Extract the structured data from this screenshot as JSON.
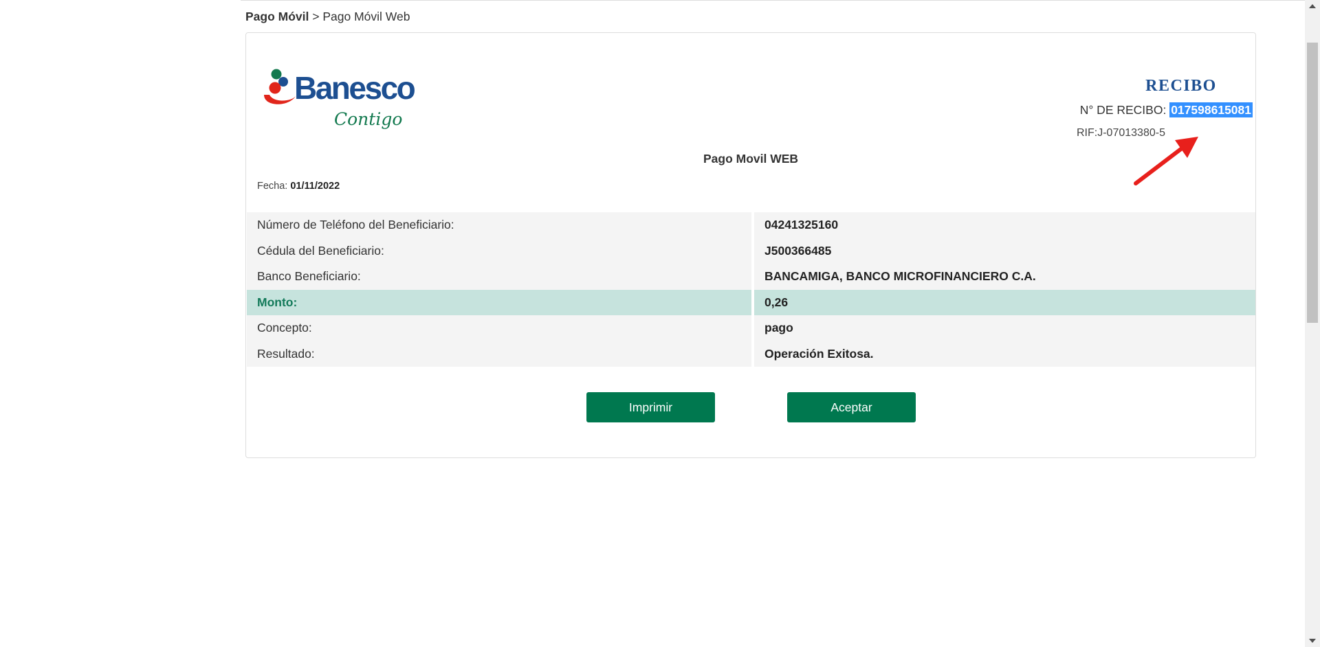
{
  "breadcrumb": {
    "root": "Pago Móvil",
    "separator": ">",
    "current": "Pago Móvil Web"
  },
  "brand": {
    "name": "Banesco",
    "tagline": "Contigo",
    "primary_color": "#1d4f91",
    "secondary_color": "#00784f",
    "accent_red": "#e1251b"
  },
  "receipt": {
    "title": "RECIBO",
    "number_label": "N° DE RECIBO:",
    "number": "017598615081",
    "rif": "RIF:J-07013380-5",
    "doc_title": "Pago Movil WEB",
    "date_label": "Fecha:",
    "date": "01/11/2022"
  },
  "details": [
    {
      "label": "Número de Teléfono del Beneficiario:",
      "value": "04241325160"
    },
    {
      "label": "Cédula del Beneficiario:",
      "value": "J500366485"
    },
    {
      "label": "Banco Beneficiario:",
      "value": "BANCAMIGA, BANCO MICROFINANCIERO C.A."
    },
    {
      "label": "Monto:",
      "value": "0,26"
    },
    {
      "label": "Concepto:",
      "value": "pago"
    },
    {
      "label": "Resultado:",
      "value": "Operación Exitosa."
    }
  ],
  "buttons": {
    "print": "Imprimir",
    "accept": "Aceptar"
  },
  "colors": {
    "button": "#00784f",
    "highlight_row": "#c6e3dd",
    "selection": "#3390ff",
    "arrow": "#e8201c"
  }
}
